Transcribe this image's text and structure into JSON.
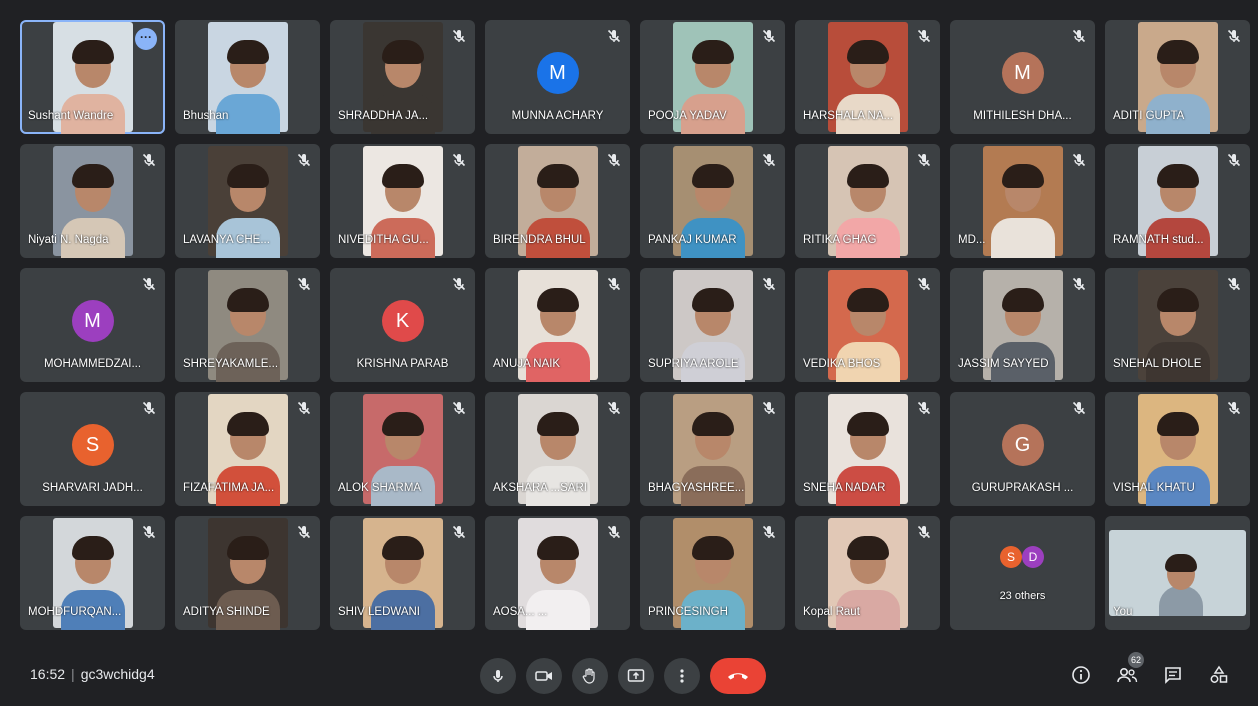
{
  "colors": {
    "tile_bg": "#3c4043",
    "end_call": "#ea4335",
    "accent": "#8ab4f8"
  },
  "participants": [
    {
      "name": "Sushant Wandre",
      "type": "video",
      "bg": "#d7dfe4",
      "shirt": "#e0b3a0",
      "active": true,
      "more": true
    },
    {
      "name": "Bhushan",
      "type": "video",
      "bg": "#c9d6e2",
      "shirt": "#6aa7d6"
    },
    {
      "name": "SHRADDHA JA...",
      "type": "video",
      "bg": "#3a3632",
      "shirt": "#3a3632",
      "muted": true
    },
    {
      "name": "MUNNA ACHARY",
      "type": "avatar",
      "initial": "M",
      "color": "#1a73e8",
      "muted": true
    },
    {
      "name": "POOJA YADAV",
      "type": "video",
      "bg": "#9fc3b8",
      "shirt": "#d7a08d",
      "muted": true
    },
    {
      "name": "HARSHALA NA...",
      "type": "video",
      "bg": "#b84d3a",
      "shirt": "#e8d9c8",
      "muted": true
    },
    {
      "name": "MITHILESH DHA...",
      "type": "avatar",
      "initial": "M",
      "color": "#b5735a",
      "muted": true
    },
    {
      "name": "ADITI GUPTA",
      "type": "video",
      "bg": "#c9a98b",
      "shirt": "#8fb1cc",
      "muted": true
    },
    {
      "name": "Niyati N. Nagda",
      "type": "video",
      "bg": "#8a94a0",
      "shirt": "#d5c7b6",
      "muted": true
    },
    {
      "name": "LAVANYA CHE...",
      "type": "video",
      "bg": "#4a4038",
      "shirt": "#a8c4d8",
      "muted": true
    },
    {
      "name": "NIVEDITHA GU...",
      "type": "video",
      "bg": "#ece7e2",
      "shirt": "#cc6b5a",
      "muted": true
    },
    {
      "name": "BIRENDRA BHUL",
      "type": "video",
      "bg": "#c2ad9a",
      "shirt": "#c04f3c",
      "muted": true
    },
    {
      "name": "PANKAJ KUMAR",
      "type": "video",
      "bg": "#a68f72",
      "shirt": "#3f92c3",
      "muted": true
    },
    {
      "name": "RITIKA GHAG",
      "type": "video",
      "bg": "#d6c4b4",
      "shirt": "#f2a7a7",
      "muted": true
    },
    {
      "name": "MD...",
      "type": "video",
      "bg": "#b37b52",
      "shirt": "#e9e2da",
      "muted": true
    },
    {
      "name": "RAMNATH stud...",
      "type": "video",
      "bg": "#c8cfd6",
      "shirt": "#b4473e",
      "muted": true
    },
    {
      "name": "MOHAMMEDZAI...",
      "type": "avatar",
      "initial": "M",
      "color": "#9c3fbf",
      "muted": true
    },
    {
      "name": "SHREYAKAMLE...",
      "type": "video",
      "bg": "#8f8a80",
      "shirt": "#6d6259",
      "muted": true
    },
    {
      "name": "KRISHNA PARAB",
      "type": "avatar",
      "initial": "K",
      "color": "#e04a4a",
      "muted": true
    },
    {
      "name": "ANUJA NAIK",
      "type": "video",
      "bg": "#e7e0d8",
      "shirt": "#e06464",
      "muted": true
    },
    {
      "name": "SUPRIYA AROLE",
      "type": "video",
      "bg": "#cdc8c6",
      "shirt": "#cfcfd6",
      "muted": true
    },
    {
      "name": "VEDIKA BHOS",
      "type": "video",
      "bg": "#d4694d",
      "shirt": "#f0d4b0",
      "muted": true
    },
    {
      "name": "JASSIM SAYYED",
      "type": "video",
      "bg": "#b6b1aa",
      "shirt": "#5a6068",
      "muted": true
    },
    {
      "name": "SNEHAL DHOLE",
      "type": "video",
      "bg": "#4b423b",
      "shirt": "#3e3631",
      "muted": true
    },
    {
      "name": "SHARVARI JADH...",
      "type": "avatar",
      "initial": "S",
      "color": "#e8622e",
      "muted": true
    },
    {
      "name": "FIZAFATIMA JA...",
      "type": "video",
      "bg": "#e3d6c2",
      "shirt": "#d2503b",
      "muted": true
    },
    {
      "name": "ALOK SHARMA",
      "type": "video",
      "bg": "#c76a6a",
      "shirt": "#a9b9c8",
      "muted": true
    },
    {
      "name": "AKSHARA ...SARI",
      "type": "video",
      "bg": "#dad6d2",
      "shirt": "#e7e5e2",
      "muted": true
    },
    {
      "name": "BHAGYASHREE...",
      "type": "video",
      "bg": "#b99e82",
      "shirt": "#8a6d5a",
      "muted": true
    },
    {
      "name": "SNEHA NADAR",
      "type": "video",
      "bg": "#e9e2dc",
      "shirt": "#cc4d44",
      "muted": true
    },
    {
      "name": "GURUPRAKASH ...",
      "type": "avatar",
      "initial": "G",
      "color": "#b5735a",
      "muted": true
    },
    {
      "name": "VISHAL KHATU",
      "type": "video",
      "bg": "#dcb680",
      "shirt": "#5a87c2",
      "muted": true
    },
    {
      "name": "MOHDFURQAN...",
      "type": "video",
      "bg": "#d3d7da",
      "shirt": "#4f7fb8",
      "muted": true
    },
    {
      "name": "ADITYA SHINDE",
      "type": "video",
      "bg": "#3d3530",
      "shirt": "#6d5c50",
      "muted": true
    },
    {
      "name": "SHIV LEDWANI",
      "type": "video",
      "bg": "#d6b48e",
      "shirt": "#4c6fa2",
      "muted": true
    },
    {
      "name": "AOSA... ... ",
      "type": "video",
      "bg": "#e0dcdd",
      "shirt": "#f2eff0",
      "muted": true
    },
    {
      "name": "PRINCESINGH",
      "type": "video",
      "bg": "#b18e6a",
      "shirt": "#6cb1c9",
      "muted": true
    },
    {
      "name": "Kopal Raut",
      "type": "video",
      "bg": "#e1c8b6",
      "shirt": "#d9a9a3",
      "muted": true
    },
    {
      "name": "23 others",
      "type": "others",
      "initials": [
        "S",
        "D"
      ],
      "dot_colors": [
        "#e8622e",
        "#9c3fbf"
      ]
    },
    {
      "name": "You",
      "type": "self",
      "bg": "#c7d3d8",
      "shirt": "#8c9aa6"
    }
  ],
  "bottom_bar": {
    "time": "16:52",
    "meeting_code": "gc3wchidg4",
    "controls": [
      {
        "name": "mic",
        "icon": "mic-icon"
      },
      {
        "name": "camera",
        "icon": "camera-icon"
      },
      {
        "name": "raise-hand",
        "icon": "hand-icon"
      },
      {
        "name": "present",
        "icon": "present-icon"
      },
      {
        "name": "more",
        "icon": "more-vert-icon"
      },
      {
        "name": "end-call",
        "icon": "phone-end-icon"
      }
    ],
    "people_count": "62"
  }
}
